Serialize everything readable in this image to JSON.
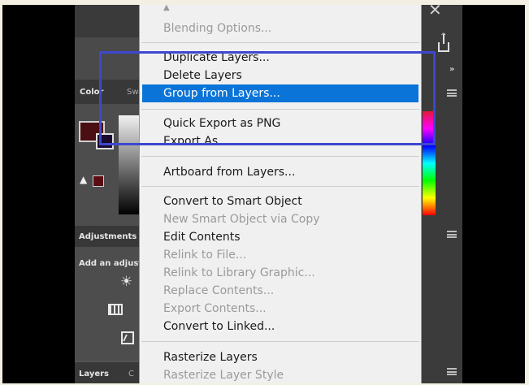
{
  "panels": {
    "color_tab": "Color",
    "swatches_tab_partial": "Sw",
    "adjustments_tab": "Adjustments",
    "adjustments_hint": "Add an adjustment",
    "layers_tab": "Layers",
    "layers_next_partial": "C"
  },
  "menu": {
    "items": [
      {
        "label": "Blending Options...",
        "enabled": false
      },
      {
        "label": "Duplicate Layers...",
        "enabled": true
      },
      {
        "label": "Delete Layers",
        "enabled": true
      },
      {
        "label": "Group from Layers...",
        "enabled": true,
        "selected": true
      },
      {
        "label": "Quick Export as PNG",
        "enabled": true
      },
      {
        "label": "Export As...",
        "enabled": true
      },
      {
        "label": "Artboard from Layers...",
        "enabled": true
      },
      {
        "label": "Convert to Smart Object",
        "enabled": true
      },
      {
        "label": "New Smart Object via Copy",
        "enabled": false
      },
      {
        "label": "Edit Contents",
        "enabled": true
      },
      {
        "label": "Relink to File...",
        "enabled": false
      },
      {
        "label": "Relink to Library Graphic...",
        "enabled": false
      },
      {
        "label": "Replace Contents...",
        "enabled": false
      },
      {
        "label": "Export Contents...",
        "enabled": false
      },
      {
        "label": "Convert to Linked...",
        "enabled": true
      },
      {
        "label": "Rasterize Layers",
        "enabled": true
      },
      {
        "label": "Rasterize Layer Style",
        "enabled": false
      }
    ]
  },
  "icons": {
    "close": "close-icon",
    "share": "share-icon",
    "collapse": "double-chevron-icon",
    "panel_menu": "hamburger-menu-icon",
    "warning": "warning-icon",
    "brightness": "brightness-icon",
    "channel_mixer": "channel-mixer-icon",
    "curves": "curves-icon",
    "scroll_up": "scroll-up-arrow-icon"
  },
  "colors": {
    "selection": "#0a74d8",
    "annotation_box": "#3d47cf",
    "foreground_swatch": "#4a0f12",
    "background_swatch": "#1a0a30"
  }
}
